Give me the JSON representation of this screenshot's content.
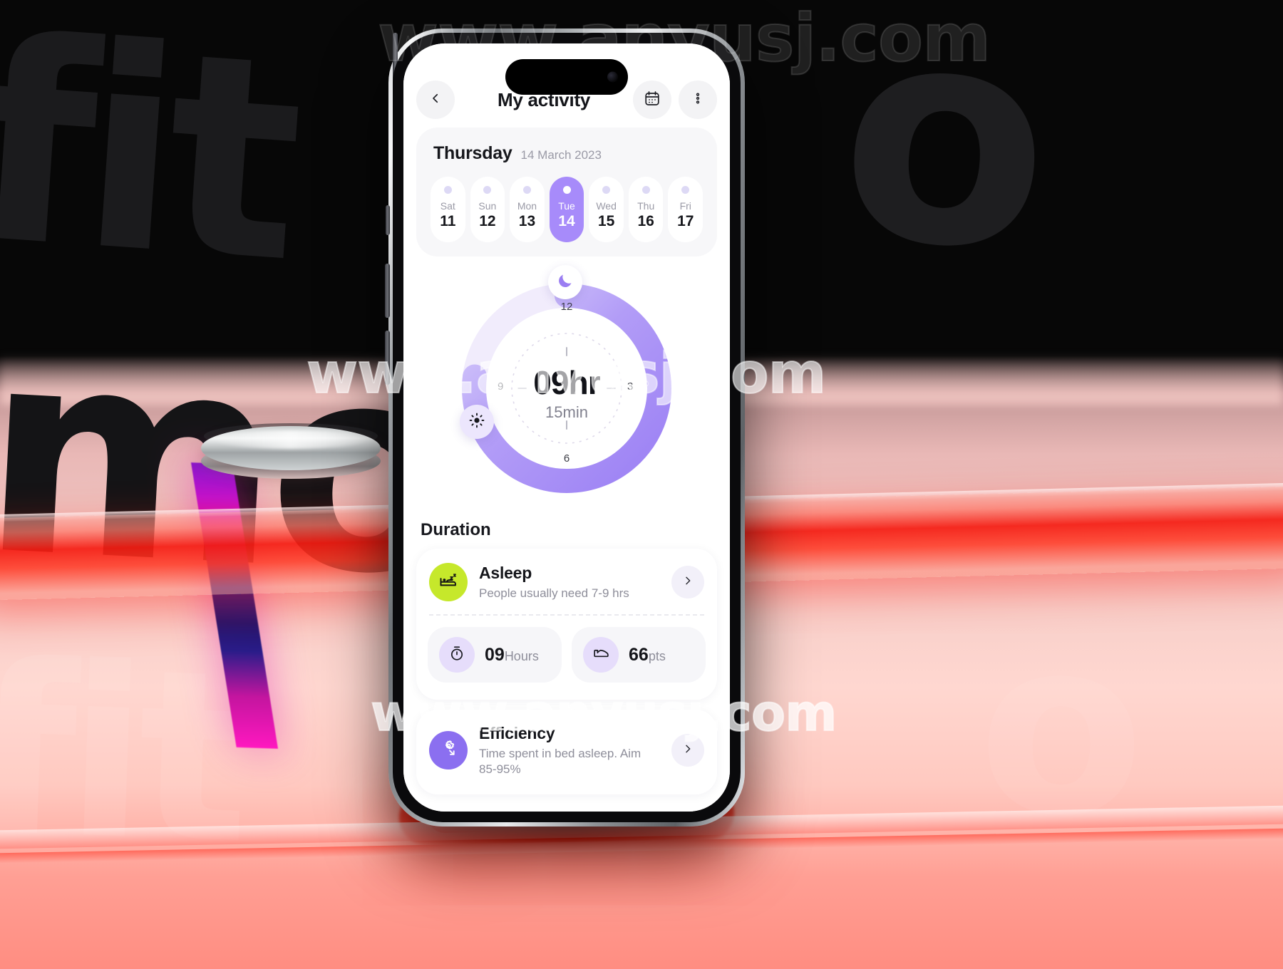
{
  "scene": {
    "background_watermarks": [
      "fit",
      "o",
      "mo",
      "fit",
      "o"
    ],
    "site_watermarks": [
      "www.anyusj.com",
      "www.anyusj.com",
      "www.anyusj.com"
    ],
    "colors": {
      "accent_purple": "#8b6ff0",
      "accent_purple_light": "#a78bfa",
      "lime": "#c6e82b",
      "red_glow": "#fa1200",
      "pink_floor": "#ffd7d0",
      "leg_magenta": "#ff18c0",
      "leg_blue": "#1b1470"
    }
  },
  "app": {
    "header": {
      "title": "My activity",
      "back_icon": "chevron-left-icon",
      "calendar_icon": "calendar-icon",
      "more_icon": "more-vertical-icon"
    },
    "date": {
      "weekday": "Thursday",
      "full": "14 March 2023"
    },
    "days": [
      {
        "weekday": "Sat",
        "number": "11",
        "selected": false
      },
      {
        "weekday": "Sun",
        "number": "12",
        "selected": false
      },
      {
        "weekday": "Mon",
        "number": "13",
        "selected": false
      },
      {
        "weekday": "Tue",
        "number": "14",
        "selected": true
      },
      {
        "weekday": "Wed",
        "number": "15",
        "selected": false
      },
      {
        "weekday": "Thu",
        "number": "16",
        "selected": false
      },
      {
        "weekday": "Fri",
        "number": "17",
        "selected": false
      }
    ],
    "ring": {
      "hours": "09hr",
      "minutes": "15min",
      "ticks": [
        "12",
        "3",
        "6",
        "9"
      ],
      "start_icon": "moon-icon",
      "end_icon": "sun-icon",
      "arc_start_hour": 12,
      "arc_end_hour": 9.25,
      "track_color": "#f0ecfb",
      "progress_from": "#c4b5fd",
      "progress_to": "#9f85f5"
    },
    "duration": {
      "section_title": "Duration",
      "items": [
        {
          "title": "Asleep",
          "subtitle": "People usually need 7-9 hrs",
          "icon": "bed-sleep-icon",
          "icon_color": "#c6e82b",
          "chevron": "chevron-right-icon"
        },
        {
          "title": "Efficiency",
          "subtitle": "Time spent in bed asleep. Aim 85-95%",
          "icon": "gear-arrow-icon",
          "icon_color": "#8b6ff0",
          "chevron": "chevron-right-icon"
        }
      ],
      "stats": [
        {
          "value": "09",
          "unit": "Hours",
          "icon": "stopwatch-icon"
        },
        {
          "value": "66",
          "unit": "pts",
          "icon": "shoe-icon"
        }
      ]
    }
  }
}
